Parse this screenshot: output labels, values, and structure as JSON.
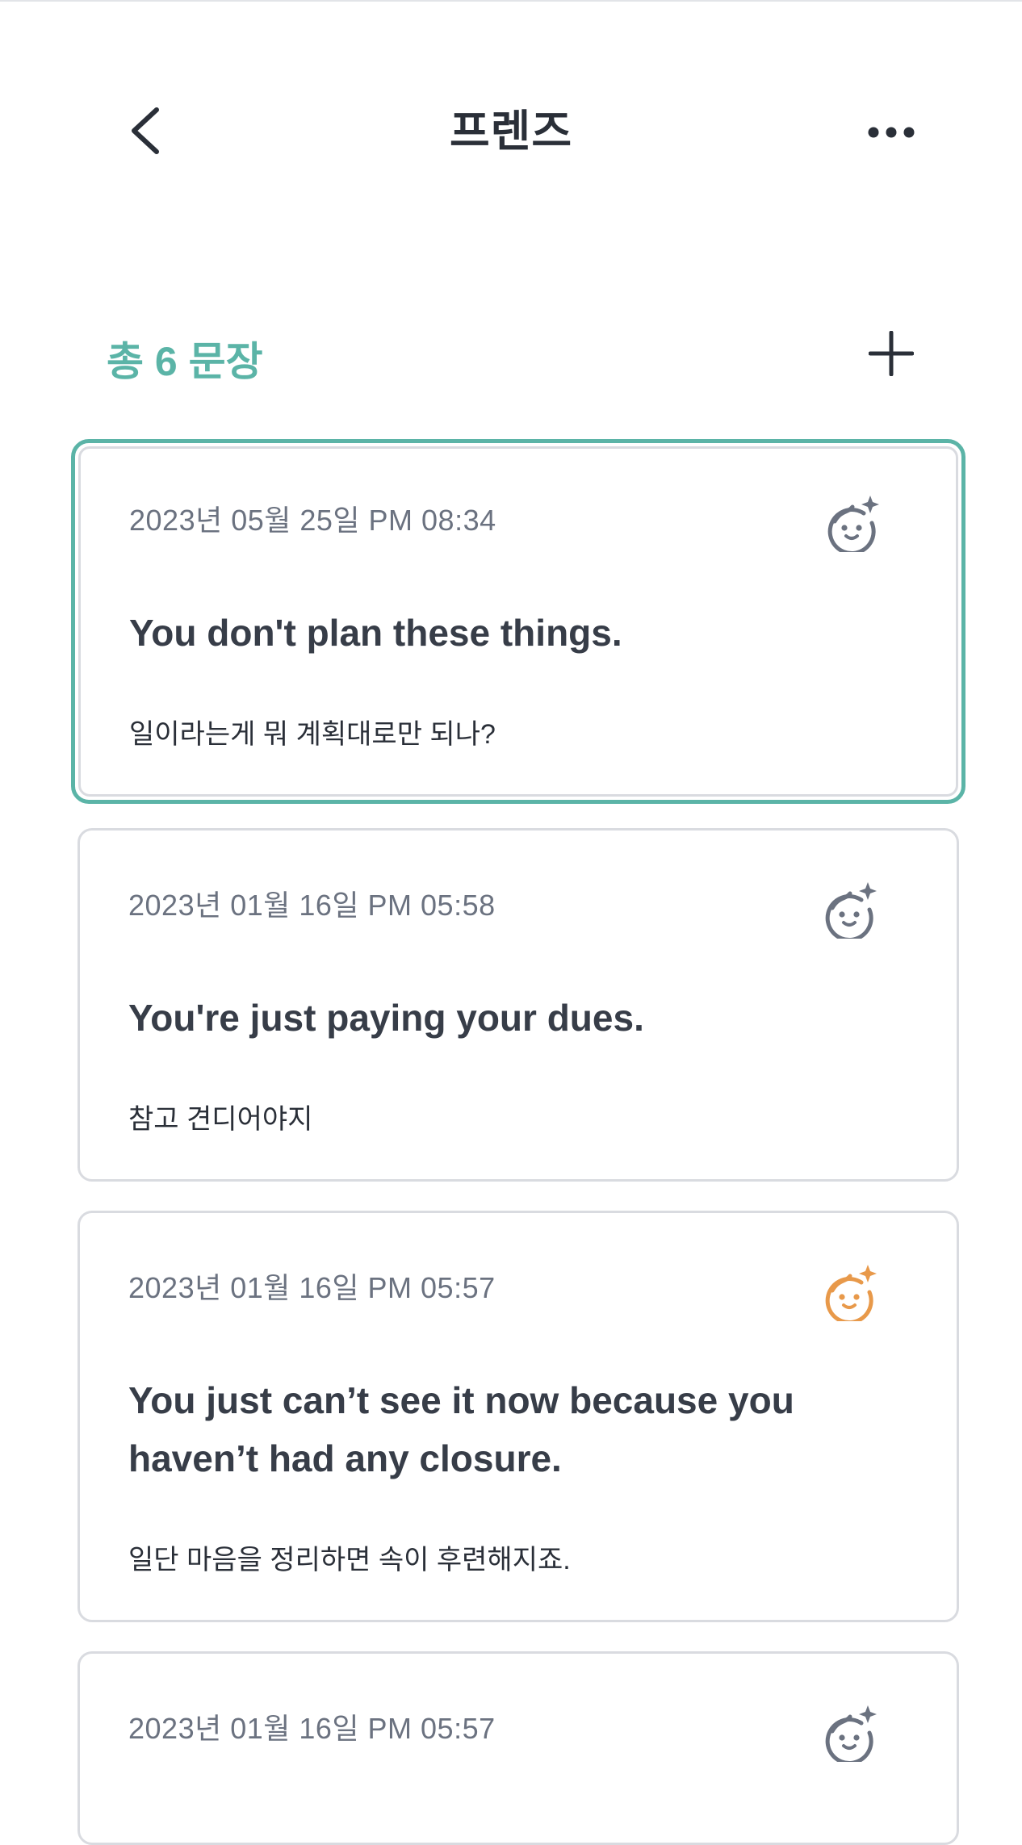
{
  "header": {
    "title": "프렌즈",
    "back_icon": "chevron-left-icon",
    "more_icon": "more-horizontal-icon"
  },
  "summary": {
    "count_label": "총 6 문장",
    "add_icon": "plus-icon"
  },
  "colors": {
    "accent": "#5bb4a7",
    "icon_gray": "#6b7280",
    "icon_orange": "#e8994a",
    "card_border": "#d9dbe0",
    "text_dark": "#373d48"
  },
  "cards": [
    {
      "date": "2023년 05월 25일 PM 08:34",
      "sentence": "You don't plan these things.",
      "translation": "일이라는게 뭐 계획대로만 되나?",
      "icon": "face-sparkle-icon",
      "icon_color": "gray",
      "selected": true
    },
    {
      "date": "2023년 01월 16일 PM 05:58",
      "sentence": "You're just paying your dues.",
      "translation": "참고 견디어야지",
      "icon": "face-sparkle-icon",
      "icon_color": "gray",
      "selected": false
    },
    {
      "date": "2023년 01월 16일 PM 05:57",
      "sentence": "You just can’t see it now because you haven’t had any closure.",
      "translation": "일단 마음을 정리하면 속이 후련해지죠.",
      "icon": "face-sparkle-icon",
      "icon_color": "orange",
      "selected": false
    },
    {
      "date": "2023년 01월 16일 PM 05:57",
      "icon": "face-sparkle-icon",
      "icon_color": "gray",
      "selected": false
    }
  ]
}
